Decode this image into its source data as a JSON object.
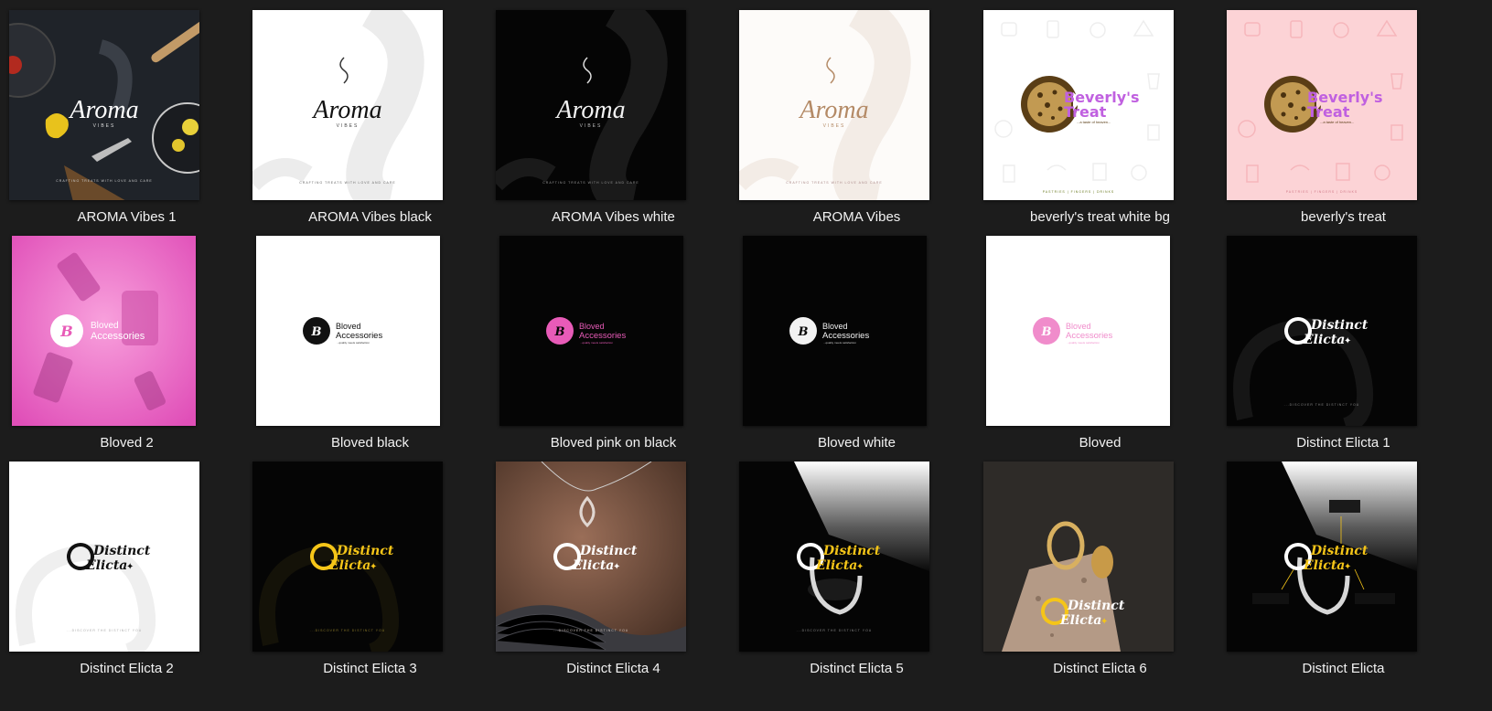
{
  "items": [
    {
      "label": "AROMA Vibes 1"
    },
    {
      "label": "AROMA Vibes black"
    },
    {
      "label": "AROMA Vibes white"
    },
    {
      "label": "AROMA Vibes"
    },
    {
      "label": "beverly's treat white bg"
    },
    {
      "label": "beverly's treat"
    },
    {
      "label": "Bloved 2"
    },
    {
      "label": "Bloved black"
    },
    {
      "label": "Bloved pink on black"
    },
    {
      "label": "Bloved white"
    },
    {
      "label": "Bloved"
    },
    {
      "label": "Distinct Elicta 1"
    },
    {
      "label": "Distinct Elicta 2"
    },
    {
      "label": "Distinct Elicta 3"
    },
    {
      "label": "Distinct Elicta 4"
    },
    {
      "label": "Distinct Elicta 5"
    },
    {
      "label": "Distinct Elicta 6"
    },
    {
      "label": "Distinct Elicta"
    }
  ],
  "logos": {
    "aroma": "Aroma",
    "aroma_sub": "VIBES",
    "aroma_tag": "CRAFTING TREATS WITH LOVE AND CARE",
    "beverly_1": "Beverly's",
    "beverly_2": "Treat",
    "beverly_tag": "...a taste of heaven...",
    "beverly_foot": "PASTRIES | FINGERS | DRINKS",
    "bloved_1": "Bloved",
    "bloved_2": "Accessories",
    "bloved_tag": "...quality meets satisfaction",
    "elicta_1": "Distinct",
    "elicta_2": "Elicta",
    "elicta_foot": "...DISCOVER THE DISTINCT YOU"
  },
  "colors": {
    "window_bg": "#1c1c1c",
    "caption_text": "#f2f2f2",
    "pink_accent": "#e85bb8",
    "gold_accent": "#f5c518",
    "purple_accent": "#c060e0",
    "cookie_brown": "#5a3e16"
  }
}
